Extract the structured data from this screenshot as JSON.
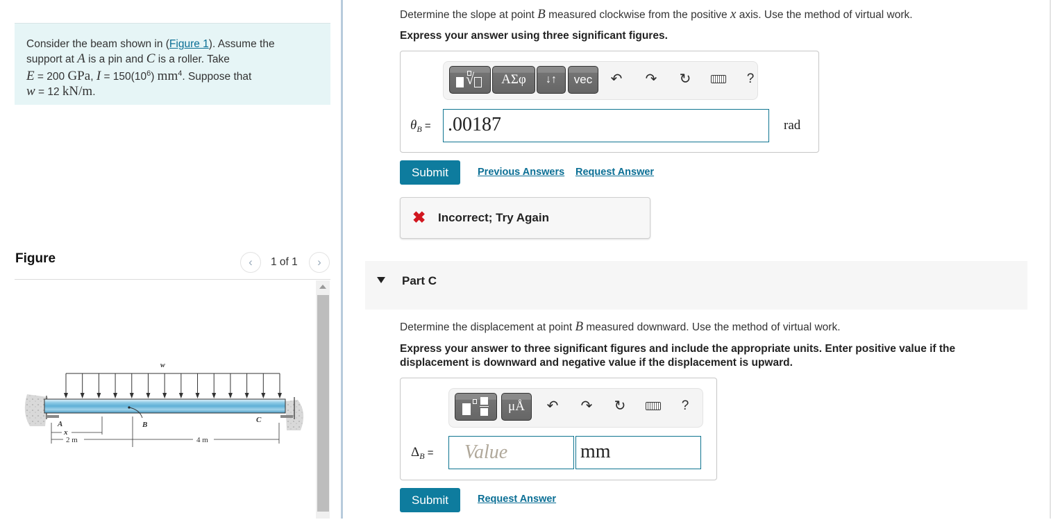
{
  "problem": {
    "intro_prefix": "Consider the beam shown in (",
    "figure_link": "Figure 1",
    "intro_suffix": "). Assume the",
    "line2_a": "support at ",
    "var_A": "A",
    "line2_b": " is a pin and ",
    "var_C": "C",
    "line2_c": " is a roller. Take",
    "E_var": "E",
    "E_eq": " = 200 ",
    "E_unit": "GPa",
    "comma": ", ",
    "I_var": "I",
    "I_eq": " = 150(10",
    "I_exp": "6",
    "I_close": ") ",
    "I_unit": "mm",
    "I_unit_exp": "4",
    "suppose": ". Suppose that",
    "w_var": "w",
    "w_eq": " = 12 ",
    "w_unit": "kN/m",
    "w_end": "."
  },
  "figure": {
    "title": "Figure",
    "counter": "1 of 1",
    "prev_icon": "chevron-left-icon",
    "next_icon": "chevron-right-icon",
    "labels": {
      "w": "w",
      "A": "A",
      "B": "B",
      "C": "C",
      "x": "x",
      "dim1": "2 m",
      "dim2": "4 m"
    }
  },
  "partB": {
    "question_prefix": "Determine the slope at point ",
    "question_var": "B",
    "question_mid": " measured clockwise from the positive ",
    "question_x": "x",
    "question_suffix": " axis. Use the method of virtual work.",
    "instruction": "Express your answer using three significant figures.",
    "toolbar": {
      "templates_icon": "templates-icon",
      "greek_label": "ΑΣφ",
      "arrows_label": "↓↑",
      "vec_label": "vec",
      "undo_icon": "undo-icon",
      "redo_icon": "redo-icon",
      "reset_icon": "reset-icon",
      "keyboard_icon": "keyboard-icon",
      "help_label": "?"
    },
    "answer_var": "θ",
    "answer_sub": "B",
    "answer_eq": " =",
    "answer_value": ".00187",
    "unit": "rad",
    "submit_label": "Submit",
    "previous_answers_label": "Previous Answers",
    "request_answer_label": "Request Answer",
    "feedback": "Incorrect; Try Again",
    "feedback_color": "#d1161f"
  },
  "partC": {
    "title": "Part C",
    "question_prefix": "Determine the displacement at point ",
    "question_var": "B",
    "question_suffix": " measured downward. Use the method of virtual work.",
    "instruction_line1": "Express your answer to three significant figures and include the appropriate units. Enter positive value if the",
    "instruction_line2": "displacement is downward and negative value if the displacement is upward.",
    "toolbar": {
      "units_template_icon": "units-template-icon",
      "units_label": "μÅ",
      "help_label": "?"
    },
    "answer_var": "Δ",
    "answer_sub": "B",
    "answer_eq": " =",
    "value_placeholder": "Value",
    "unit_value": "mm",
    "submit_label": "Submit",
    "request_answer_label": "Request Answer"
  },
  "colors": {
    "accent": "#0e7c9e",
    "link": "#0b6f95",
    "problem_bg": "#e6f5f6",
    "error": "#d1161f"
  }
}
